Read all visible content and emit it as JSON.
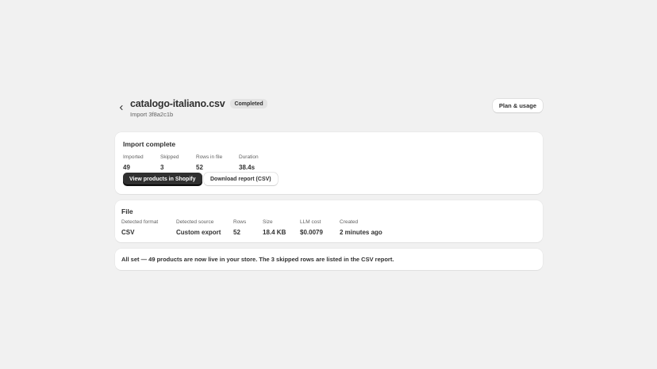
{
  "header": {
    "back_icon": "chevron-left-icon",
    "title": "catalogo-italiano.csv",
    "status_badge": "Completed",
    "subtitle": "Import 3f8a2c1b",
    "plan_button": "Plan & usage"
  },
  "import_card": {
    "title": "Import complete",
    "stats": [
      {
        "label": "Imported",
        "value": "49"
      },
      {
        "label": "Skipped",
        "value": "3"
      },
      {
        "label": "Rows in file",
        "value": "52"
      },
      {
        "label": "Duration",
        "value": "38.4s"
      }
    ],
    "primary_button": "View products in Shopify",
    "secondary_button": "Download report (CSV)"
  },
  "file_card": {
    "title": "File",
    "stats": [
      {
        "label": "Detected format",
        "value": "CSV"
      },
      {
        "label": "Detected source",
        "value": "Custom export"
      },
      {
        "label": "Rows",
        "value": "52"
      },
      {
        "label": "Size",
        "value": "18.4 KB"
      },
      {
        "label": "LLM cost",
        "value": "$0.0079"
      },
      {
        "label": "Created",
        "value": "2 minutes ago"
      }
    ]
  },
  "message_card": {
    "text": "All set — 49 products are now live in your store. The 3 skipped rows are listed in the CSV report."
  },
  "colors": {
    "background": "#f1f1f1",
    "card": "#ffffff",
    "primary_button": "#303030",
    "badge": "#e3e3e3",
    "text": "#303030",
    "muted_text": "#616161"
  }
}
